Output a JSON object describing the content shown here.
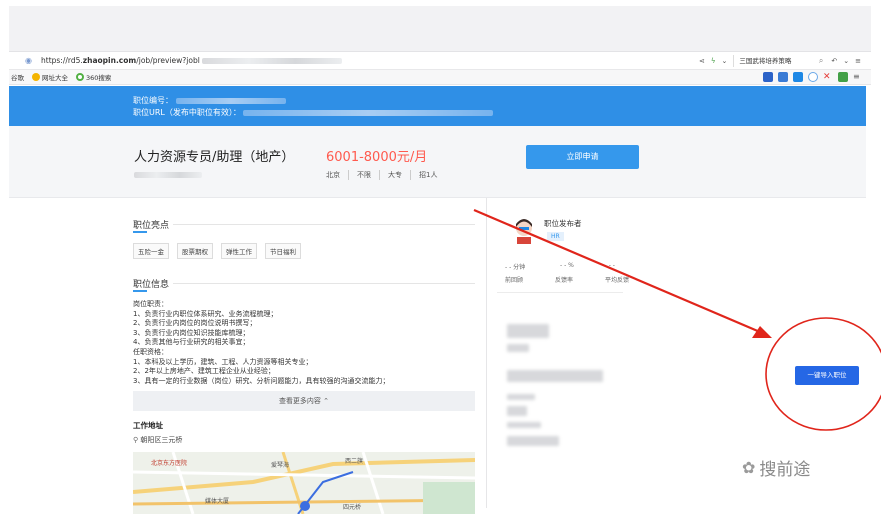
{
  "browser": {
    "url_prefix": "https://rd5.",
    "url_domain": "zhaopin.com",
    "url_path": "/job/preview?jobl",
    "search_text": "三国武将培养策略",
    "bookmarks": [
      "谷歌",
      "网址大全",
      "360搜索"
    ]
  },
  "banner": {
    "job_id_label": "职位编号：",
    "job_url_label": "职位URL（发布中职位有效）："
  },
  "job": {
    "title": "人力资源专员/助理（地产）",
    "salary": "6001-8000元/月",
    "tags": [
      "北京",
      "不限",
      "大专",
      "招1人"
    ],
    "apply_label": "立即申请"
  },
  "highlights": {
    "title": "职位亮点",
    "chips": [
      "五险一金",
      "股票期权",
      "弹性工作",
      "节日福利"
    ]
  },
  "info": {
    "title": "职位信息",
    "description": "岗位职责：\n1、负责行业内职位体系研究、业务流程梳理；\n2、负责行业内岗位的岗位说明书撰写；\n3、负责行业内岗位知识技能库梳理；\n4、负责其他与行业研究的相关事宜；\n任职资格：\n1、本科及以上学历，建筑、工程、人力资源等相关专业；\n2、2年以上房地产、建筑工程企业从业经验；\n3、具有一定的行业数据（岗位）研究、分析问题能力，具有较强的沟通交流能力；",
    "more_label": "查看更多内容",
    "more_icon": "chevron-up-icon"
  },
  "workplace": {
    "title": "工作地址",
    "location": "朝阳区三元桥",
    "map_labels": [
      "北京东方医院",
      "爱琴海",
      "西二旗",
      "媒体大厦",
      "四元桥"
    ]
  },
  "publisher": {
    "label": "职位发布者",
    "badge": "HR",
    "stats": [
      "- - 分钟",
      "- - %",
      "- -"
    ],
    "stat_labels": [
      "前回顾",
      "反馈率",
      "平均反馈"
    ]
  },
  "import_button": "一键导入职位",
  "watermark": "搜前途",
  "colors": {
    "banner_blue": "#2f8fe6",
    "salary_red": "#ff5a4e",
    "apply_blue": "#3598ec",
    "import_blue": "#2567e5",
    "annotation_red": "#e0251b"
  }
}
